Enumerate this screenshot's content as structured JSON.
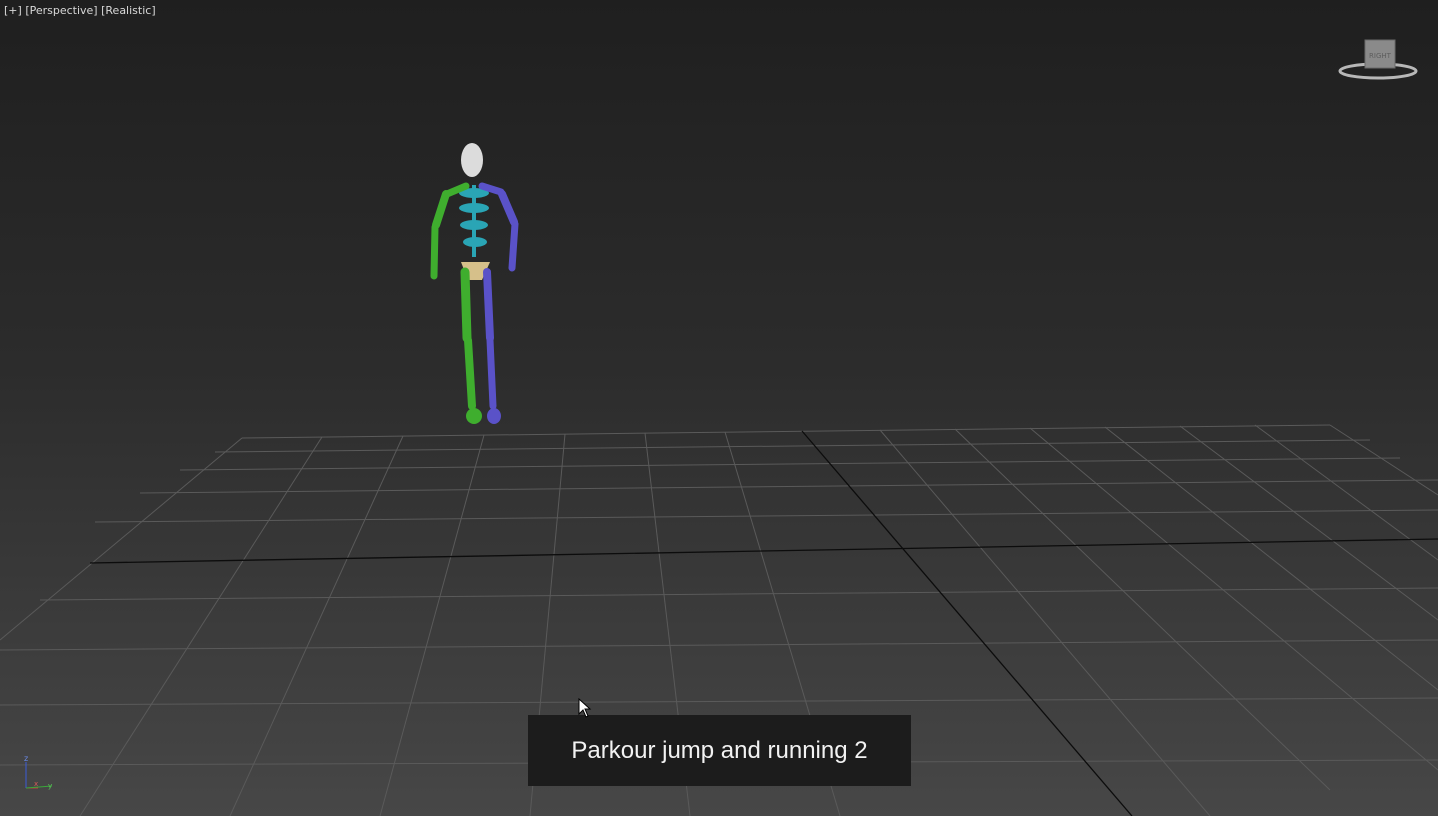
{
  "viewport": {
    "labels": [
      "[+]",
      "[Perspective]",
      "[Realistic]"
    ]
  },
  "viewcube": {
    "face_label": "RIGHT"
  },
  "caption": {
    "text": "Parkour jump and running 2"
  },
  "axis_tripod": {
    "z_label": "z",
    "x_label": "x",
    "y_label": "y"
  },
  "colors": {
    "background_top": "#1f1f1f",
    "background_bottom": "#474747",
    "left_limbs": "#3fae2e",
    "right_limbs": "#5a52c8",
    "spine": "#2aa5b5",
    "pelvis": "#d6c08a",
    "skull": "#dcdcdc"
  }
}
